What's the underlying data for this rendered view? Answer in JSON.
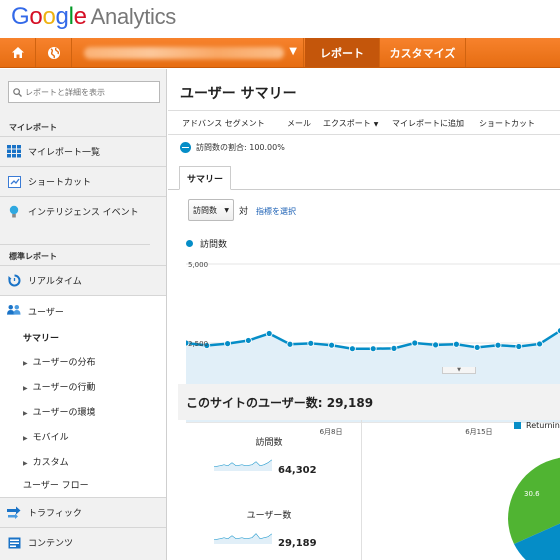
{
  "header": {
    "logo_letters": [
      "G",
      "o",
      "o",
      "g",
      "l",
      "e"
    ],
    "logo_product": "Analytics",
    "nav": {
      "report_tab": "レポート",
      "customize_tab": "カスタマイズ"
    }
  },
  "sidebar": {
    "search_placeholder": "レポートと詳細を表示",
    "my_reports_header": "マイレポート",
    "my_reports": [
      {
        "label": "マイレポート一覧",
        "icon": "grid-icon"
      },
      {
        "label": "ショートカット",
        "icon": "shortcut-icon"
      },
      {
        "label": "インテリジェンス イベント",
        "icon": "lightbulb-icon"
      }
    ],
    "standard_header": "標準レポート",
    "realtime": "リアルタイム",
    "users": "ユーザー",
    "summary": "サマリー",
    "user_subitems": [
      "ユーザーの分布",
      "ユーザーの行動",
      "ユーザーの環境",
      "モバイル",
      "カスタム"
    ],
    "user_flow": "ユーザー フロー",
    "traffic": "トラフィック",
    "content": "コンテンツ"
  },
  "main": {
    "title": "ユーザー サマリー",
    "toolbar": {
      "advanced_segment": "アドバンス セグメント",
      "email": "メール",
      "export": "エクスポート",
      "add_to_dashboard": "マイレポートに追加",
      "shortcut": "ショートカット"
    },
    "visits_pct": "訪問数の割合: 100.00%",
    "tab_summary": "サマリー",
    "metric_select": "訪問数",
    "vs": "対",
    "pick_metric": "指標を選択",
    "legend": "訪問数",
    "users_title": "このサイトのユーザー数: 29,189",
    "metrics": [
      {
        "label": "訪問数",
        "value": "64,302"
      },
      {
        "label": "ユーザー数",
        "value": "29,189"
      }
    ],
    "pie_legend": "Returning",
    "pie_pct": "30.6"
  },
  "colors": {
    "accent": "#058dc7",
    "nav_orange": "#f07a1d",
    "nav_active": "#c4560b",
    "pie_green": "#50b432"
  },
  "chart_data": {
    "type": "line",
    "series": [
      {
        "name": "訪問数",
        "values": [
          2500,
          2420,
          2480,
          2580,
          2800,
          2460,
          2490,
          2430,
          2320,
          2320,
          2330,
          2500,
          2440,
          2460,
          2360,
          2430,
          2390,
          2470,
          2890,
          3700,
          4450
        ]
      }
    ],
    "y_ticks": [
      "5,000",
      "2,500"
    ],
    "x_ticks": [
      "6月8日",
      "6月15日"
    ],
    "ylim": [
      0,
      5000
    ]
  }
}
